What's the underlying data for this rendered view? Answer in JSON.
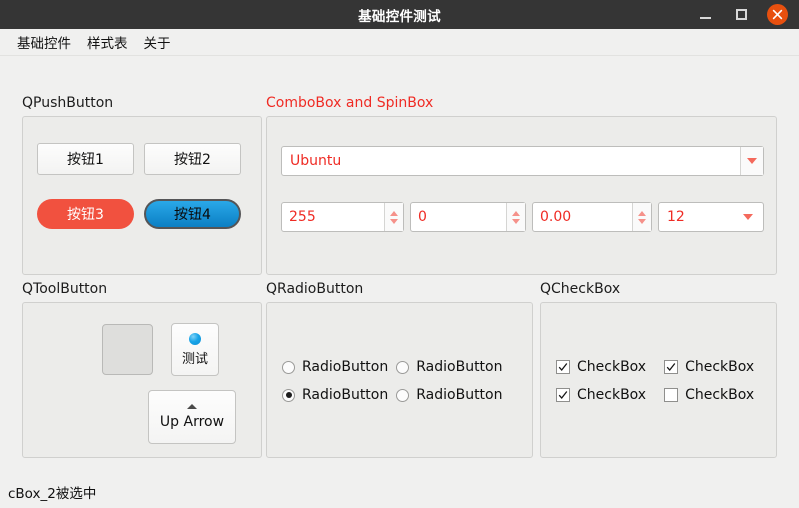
{
  "window": {
    "title": "基础控件测试",
    "controls": {
      "minimize": "minimize-icon",
      "maximize": "maximize-icon",
      "close": "close-icon"
    }
  },
  "menubar": {
    "items": [
      {
        "label": "基础控件"
      },
      {
        "label": "样式表"
      },
      {
        "label": "关于"
      }
    ]
  },
  "groups": {
    "pushbutton": {
      "title": "QPushButton",
      "buttons": [
        {
          "label": "按钮1",
          "style": "default"
        },
        {
          "label": "按钮2",
          "style": "default"
        },
        {
          "label": "按钮3",
          "style": "red-pill"
        },
        {
          "label": "按钮4",
          "style": "blue-pill"
        }
      ]
    },
    "combospin": {
      "title": "ComboBox and SpinBox",
      "title_color": "#ef2b24",
      "combo_main": {
        "value": "Ubuntu",
        "arrow": "chevron-down-icon"
      },
      "spinboxes": [
        {
          "value": "255"
        },
        {
          "value": "0"
        },
        {
          "value": "0.00"
        }
      ],
      "combo_small": {
        "value": "12",
        "arrow": "chevron-down-icon"
      }
    },
    "toolbutton": {
      "title": "QToolButton",
      "buttons": [
        {
          "label": "",
          "icon": "",
          "style": "empty"
        },
        {
          "label": "测试",
          "icon": "blue-dot-icon",
          "style": "icon-top"
        },
        {
          "label": "Up Arrow",
          "icon": "triangle-up-icon",
          "style": "arrow-top"
        }
      ]
    },
    "radiobutton": {
      "title": "QRadioButton",
      "options": [
        {
          "label": "RadioButton",
          "checked": false
        },
        {
          "label": "RadioButton",
          "checked": false
        },
        {
          "label": "RadioButton",
          "checked": true
        },
        {
          "label": "RadioButton",
          "checked": false
        }
      ]
    },
    "checkbox": {
      "title": "QCheckBox",
      "options": [
        {
          "label": "CheckBox",
          "checked": true
        },
        {
          "label": "CheckBox",
          "checked": true
        },
        {
          "label": "CheckBox",
          "checked": true
        },
        {
          "label": "CheckBox",
          "checked": false
        }
      ]
    }
  },
  "statusbar": {
    "text": "cBox_2被选中"
  }
}
